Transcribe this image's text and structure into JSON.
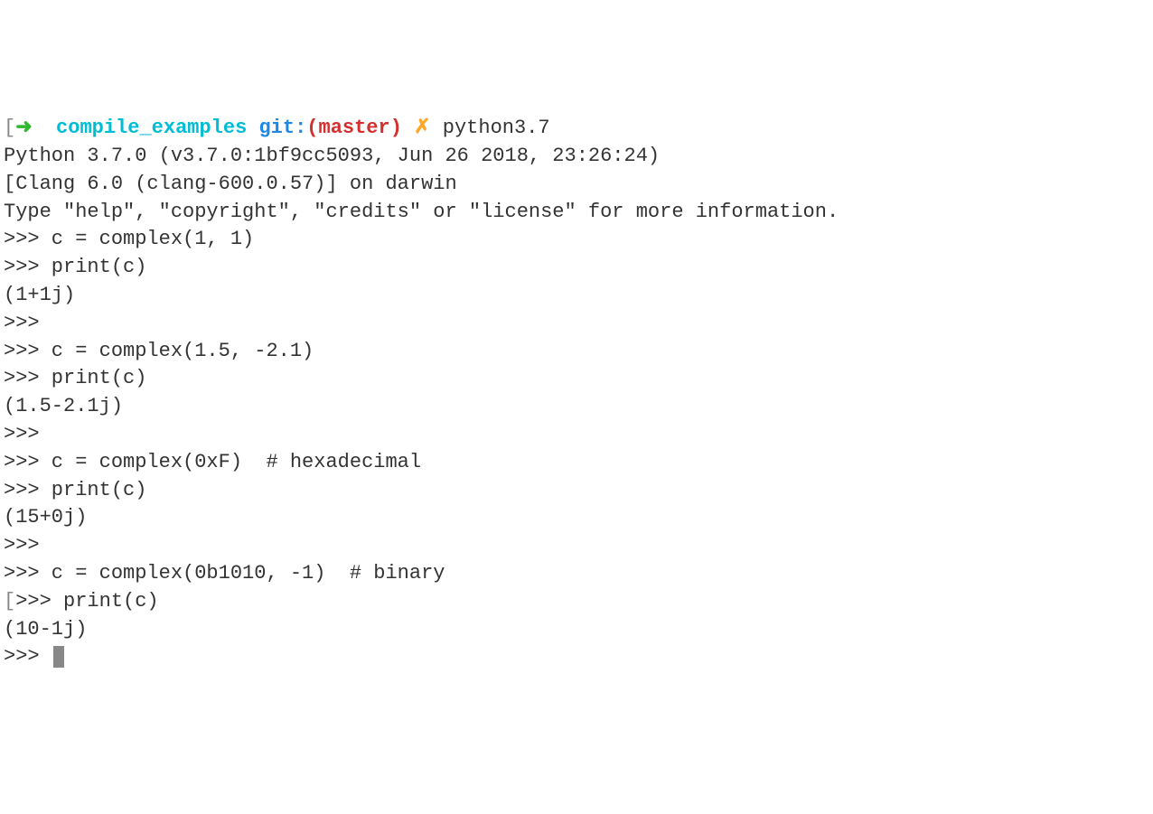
{
  "prompt": {
    "bracket_open": "[",
    "arrow": "➜",
    "path": "compile_examples",
    "git": "git",
    "colon": ":",
    "paren_open": "(",
    "branch": "master",
    "paren_close": ")",
    "dirty": "✗",
    "command": "python3.7"
  },
  "lines": [
    "Python 3.7.0 (v3.7.0:1bf9cc5093, Jun 26 2018, 23:26:24)",
    "[Clang 6.0 (clang-600.0.57)] on darwin",
    "Type \"help\", \"copyright\", \"credits\" or \"license\" for more information.",
    ">>> c = complex(1, 1)",
    ">>> print(c)",
    "(1+1j)",
    ">>>",
    ">>> c = complex(1.5, -2.1)",
    ">>> print(c)",
    "(1.5-2.1j)",
    ">>>",
    ">>> c = complex(0xF)  # hexadecimal",
    ">>> print(c)",
    "(15+0j)",
    ">>>",
    ">>> c = complex(0b1010, -1)  # binary"
  ],
  "line_bracket": {
    "bracket": "[",
    "content": ">>> print(c)"
  },
  "tail": [
    "(10-1j)",
    ">>> "
  ]
}
